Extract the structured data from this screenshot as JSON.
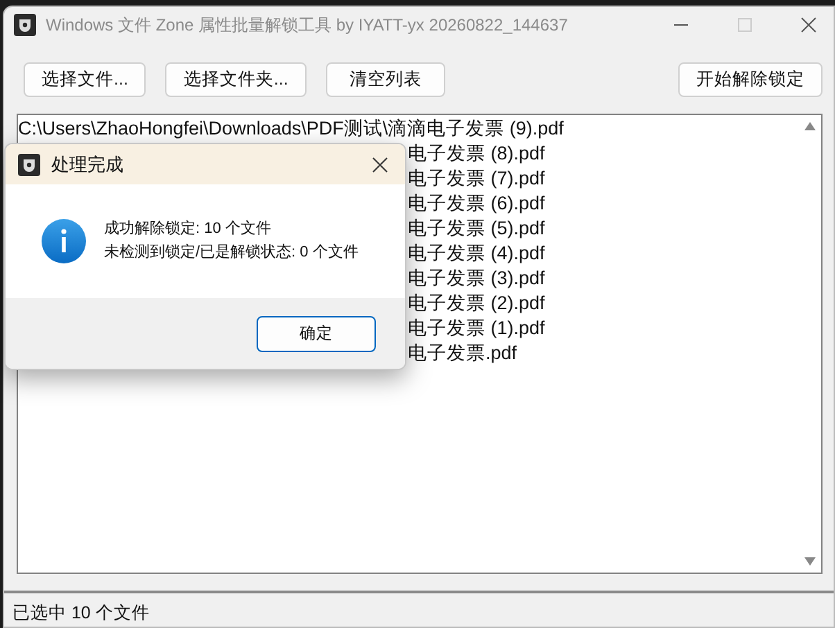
{
  "window": {
    "title": "Windows 文件 Zone 属性批量解锁工具 by IYATT-yx 20260822_144637"
  },
  "toolbar": {
    "left_buttons": [
      "选择文件...",
      "选择文件夹...",
      "清空列表"
    ],
    "right_button": "开始解除锁定"
  },
  "file_list": [
    {
      "text": "C:\\Users\\ZhaoHongfei\\Downloads\\PDF测试\\滴滴电子发票 (9).pdf",
      "covered": false
    },
    {
      "text": "电子发票 (8).pdf",
      "covered": true
    },
    {
      "text": "电子发票 (7).pdf",
      "covered": true
    },
    {
      "text": "电子发票 (6).pdf",
      "covered": true
    },
    {
      "text": "电子发票 (5).pdf",
      "covered": true
    },
    {
      "text": "电子发票 (4).pdf",
      "covered": true
    },
    {
      "text": "电子发票 (3).pdf",
      "covered": true
    },
    {
      "text": "电子发票 (2).pdf",
      "covered": true
    },
    {
      "text": "电子发票 (1).pdf",
      "covered": true
    },
    {
      "text": "电子发票.pdf",
      "covered": true
    }
  ],
  "status_bar": "已选中 10 个文件",
  "dialog": {
    "title": "处理完成",
    "messages": [
      "成功解除锁定: 10 个文件",
      "未检测到锁定/已是解锁状态: 0 个文件"
    ],
    "button": "确定"
  }
}
